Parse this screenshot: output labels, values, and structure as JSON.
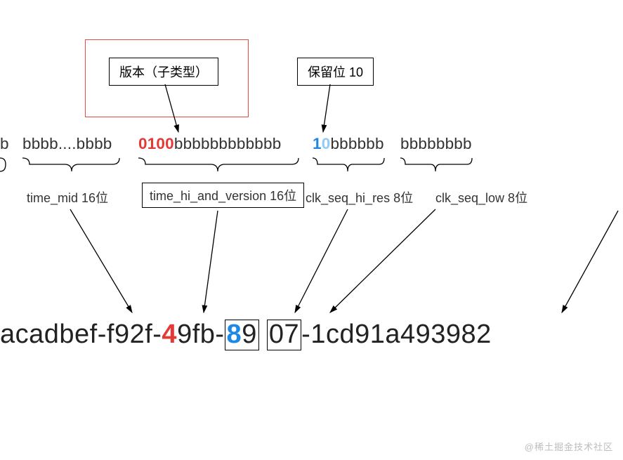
{
  "callouts": {
    "version_label": "版本（子类型）",
    "reserved_label": "保留位 10"
  },
  "bits_row": {
    "seg0_leading": "b",
    "seg_time_mid": "bbbb....bbbb",
    "seg_hiver_prefix": "0100",
    "seg_hiver_suffix": "bbbbbbbbbbbb",
    "seg_clkhi_prefix_1": "1",
    "seg_clkhi_prefix_0": "0",
    "seg_clkhi_suffix": "bbbbbb",
    "seg_clklow": "bbbbbbbb"
  },
  "fields": {
    "time_mid": "time_mid 16位",
    "time_hi_and_version": "time_hi_and_version 16位",
    "clk_seq_hi_res": "clk_seq_hi_res 8位",
    "clk_seq_low": "clk_seq_low  8位"
  },
  "uuid": {
    "p0": "acadbef-f92f-",
    "p1_4": "4",
    "p1_rest": "9fb-",
    "p2_8": "8",
    "p2_9": "9",
    "gap": " ",
    "p3_07": "07",
    "dash": "-",
    "p4_node": "1cd91a493982"
  },
  "watermark": "@稀土掘金技术社区"
}
